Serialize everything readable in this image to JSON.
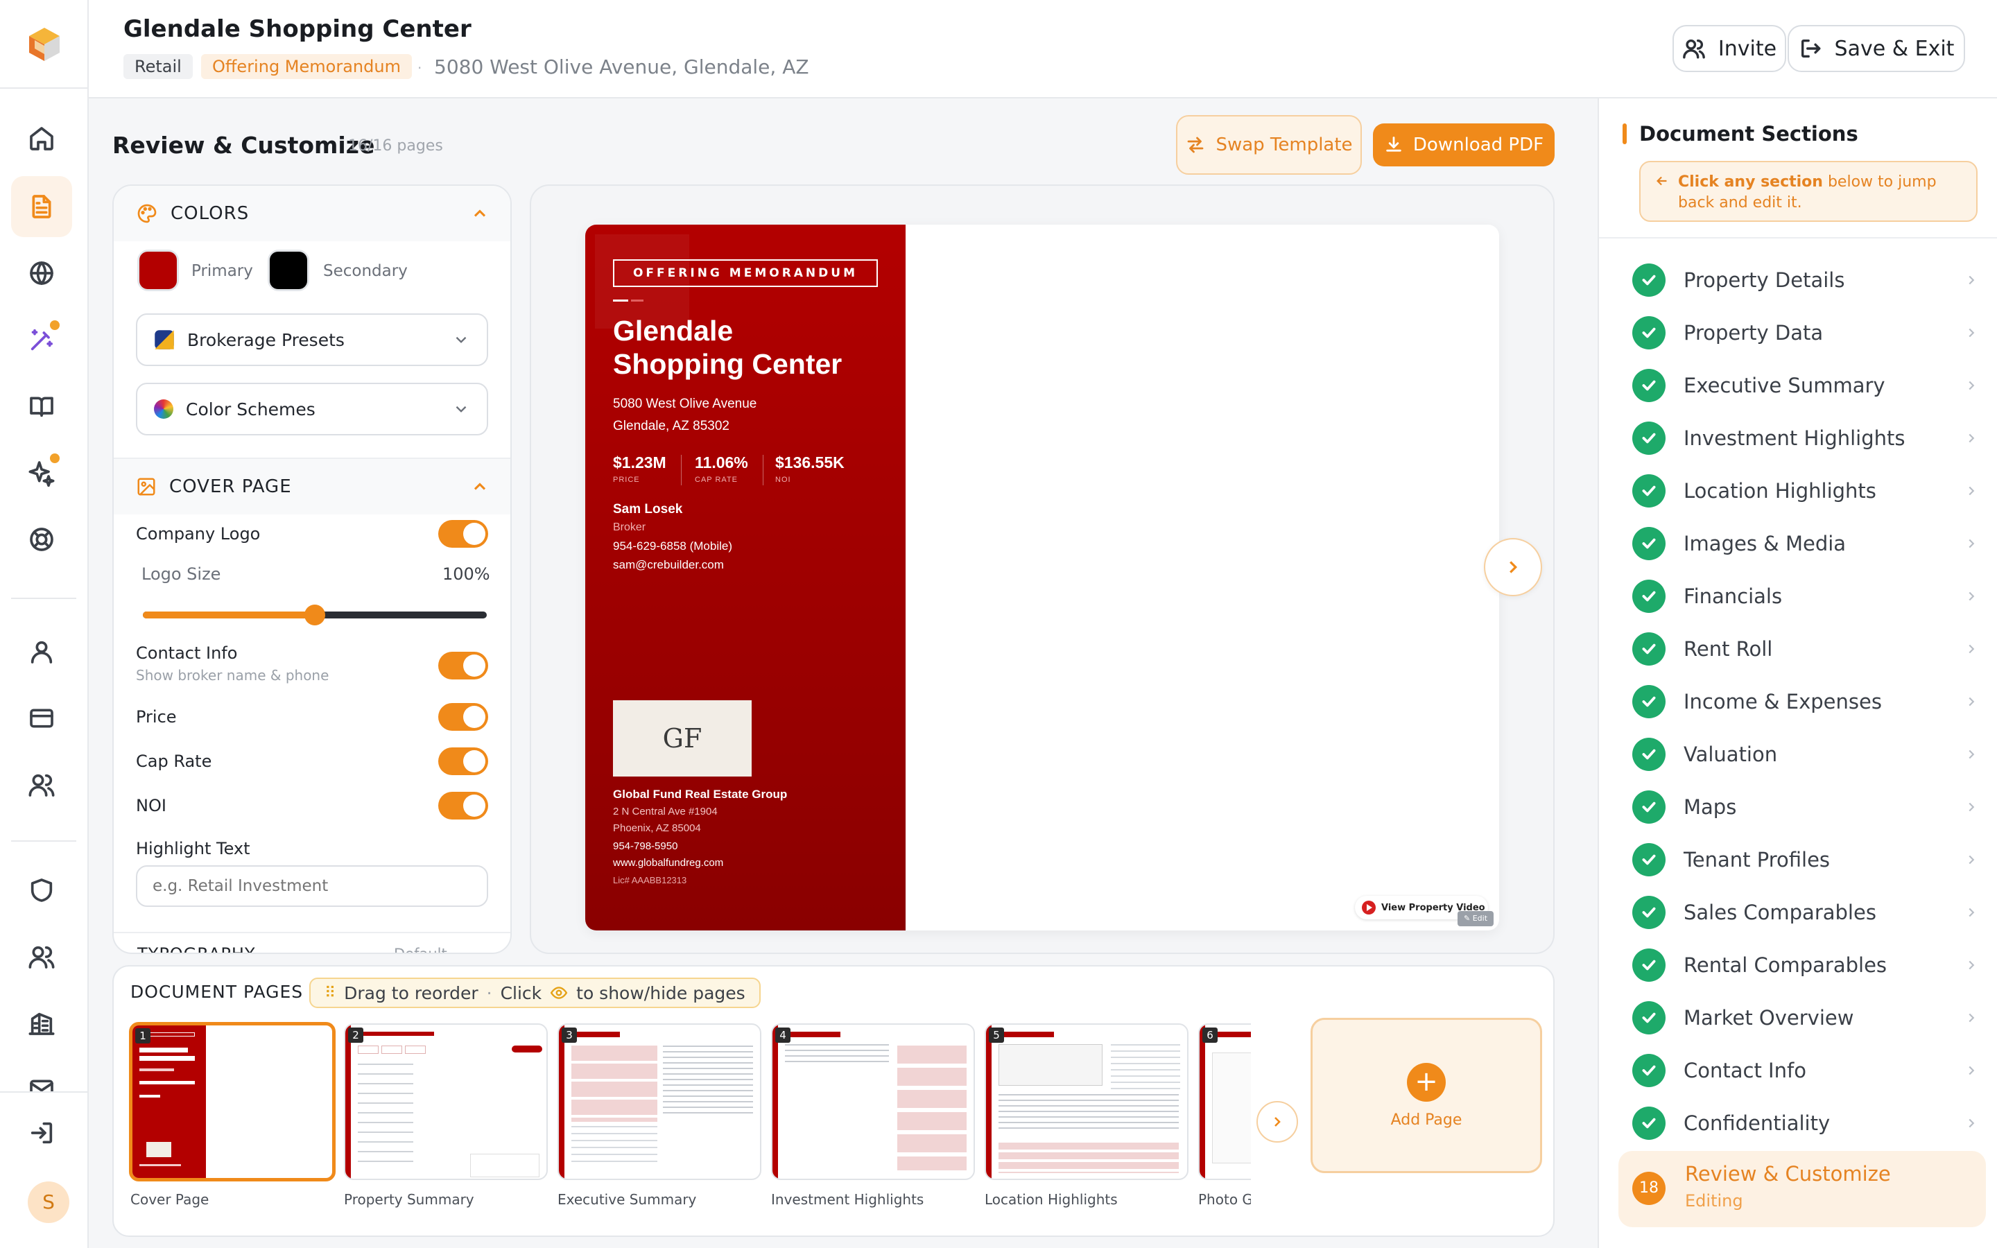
{
  "header": {
    "title": "Glendale Shopping Center",
    "tag_type": "Retail",
    "tag_doc": "Offering Memorandum",
    "address": "5080 West Olive Avenue, Glendale, AZ",
    "invite_label": "Invite",
    "save_exit_label": "Save & Exit"
  },
  "main": {
    "title": "Review & Customize",
    "pages_count": "16/16 pages",
    "swap_template_label": "Swap Template",
    "download_pdf_label": "Download PDF"
  },
  "customize": {
    "colors_title": "COLORS",
    "primary_label": "Primary",
    "secondary_label": "Secondary",
    "primary_color": "#b30000",
    "secondary_color": "#000000",
    "brokerage_presets": "Brokerage Presets",
    "color_schemes": "Color Schemes",
    "cover_title": "COVER PAGE",
    "company_logo": "Company Logo",
    "logo_size": "Logo Size",
    "logo_size_value": "100%",
    "logo_size_fraction": 0.5,
    "contact_info": "Contact Info",
    "contact_info_sub": "Show broker name & phone",
    "price": "Price",
    "cap_rate": "Cap Rate",
    "noi": "NOI",
    "highlight_text": "Highlight Text",
    "highlight_placeholder": "e.g. Retail Investment",
    "typography_title": "TYPOGRAPHY",
    "typography_value": "Default"
  },
  "preview": {
    "banner": "OFFERING MEMORANDUM",
    "title_line1": "Glendale",
    "title_line2": "Shopping Center",
    "address1": "5080 West Olive Avenue",
    "address2": "Glendale, AZ 85302",
    "price": "$1.23M",
    "price_label": "PRICE",
    "cap": "11.06%",
    "cap_label": "CAP RATE",
    "noi": "$136.55K",
    "noi_label": "NOI",
    "broker_name": "Sam Losek",
    "broker_title": "Broker",
    "broker_phone": "954-629-6858 (Mobile)",
    "broker_email": "sam@crebuilder.com",
    "logo_text": "GF",
    "company": "Global Fund Real Estate Group",
    "company_addr1": "2 N Central Ave #1904",
    "company_addr2": "Phoenix, AZ 85004",
    "company_phone": "954-798-5950",
    "company_web": "www.globalfundreg.com",
    "company_lic": "Lic# AAABB12313",
    "video_label": "View Property Video",
    "edit_label": "Edit"
  },
  "doc_pages": {
    "title": "DOCUMENT PAGES",
    "hint_drag": "Drag to reorder",
    "hint_click": "Click",
    "hint_show": "to show/hide pages",
    "add_page": "Add Page",
    "pages": [
      {
        "num": "1",
        "label": "Cover Page"
      },
      {
        "num": "2",
        "label": "Property Summary"
      },
      {
        "num": "3",
        "label": "Executive Summary"
      },
      {
        "num": "4",
        "label": "Investment Highlights"
      },
      {
        "num": "5",
        "label": "Location Highlights"
      },
      {
        "num": "6",
        "label": "Photo Gallery"
      }
    ]
  },
  "sections": {
    "title": "Document Sections",
    "hint_bold": "Click any section",
    "hint_rest": " below to jump back and edit it.",
    "items": [
      "Property Details",
      "Property Data",
      "Executive Summary",
      "Investment Highlights",
      "Location Highlights",
      "Images & Media",
      "Financials",
      "Rent Roll",
      "Income & Expenses",
      "Valuation",
      "Maps",
      "Tenant Profiles",
      "Sales Comparables",
      "Rental Comparables",
      "Market Overview",
      "Contact Info",
      "Confidentiality"
    ],
    "current_num": "18",
    "current_label": "Review & Customize",
    "current_status": "Editing"
  },
  "user": {
    "initial": "S"
  },
  "colors": {
    "accent": "#f08a1a",
    "success": "#1eaa6a",
    "brand_red": "#b30000"
  }
}
